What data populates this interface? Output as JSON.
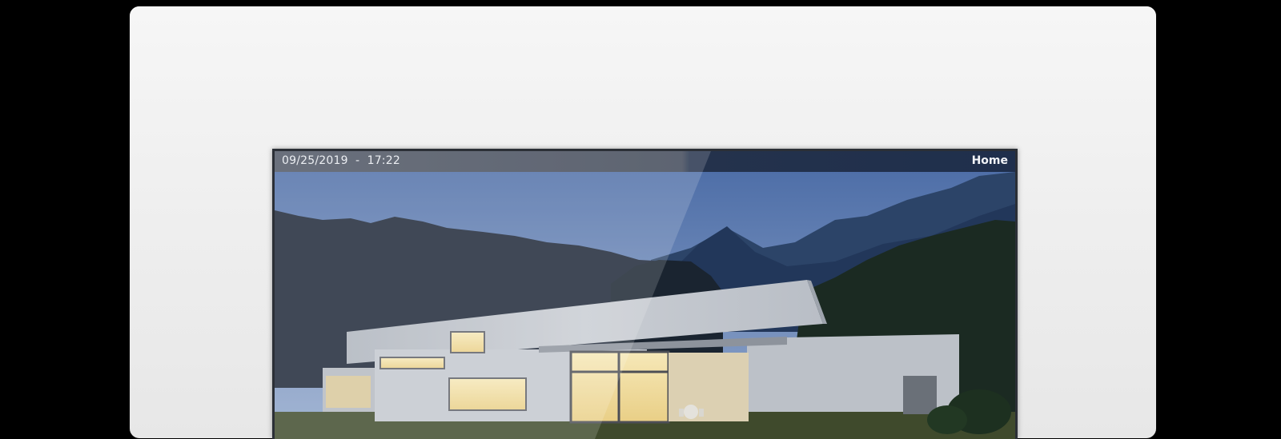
{
  "status_bar": {
    "date": "09/25/2019",
    "separator": "-",
    "time": "17:22",
    "page_title": "Home"
  },
  "wallpaper": {
    "icon": "house-wallpaper-icon",
    "scene": "modern-house-at-dusk"
  },
  "colors": {
    "bezel": "#f2f2f2",
    "status_bar_left": "#4e5563",
    "status_bar_right": "#1f2f4c",
    "sky_top": "#4f6fa8",
    "sky_bottom": "#93a9cc",
    "building": "#c7ccd3",
    "window_light": "#f1dfaa"
  }
}
